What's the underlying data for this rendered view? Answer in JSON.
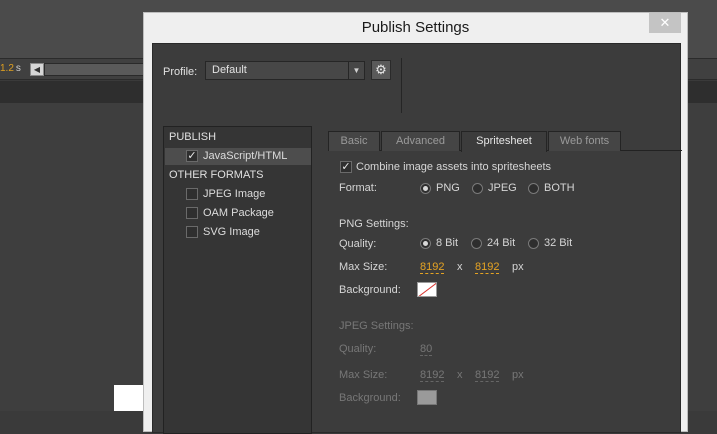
{
  "background": {
    "time_value": "1.2",
    "time_unit": "s",
    "scroll_left_glyph": "◀"
  },
  "dialog": {
    "title": "Publish Settings",
    "close_glyph": "✕",
    "profile_label": "Profile:",
    "profile_value": "Default",
    "profile_arrow": "▼",
    "gear_glyph": "⚙"
  },
  "left_panel": {
    "publish_header": "PUBLISH",
    "other_header": "OTHER FORMATS",
    "items": [
      {
        "label": "JavaScript/HTML",
        "check": "✓"
      },
      {
        "label": "JPEG Image",
        "check": ""
      },
      {
        "label": "OAM Package",
        "check": ""
      },
      {
        "label": "SVG Image",
        "check": ""
      }
    ]
  },
  "tabs": [
    {
      "label": "Basic"
    },
    {
      "label": "Advanced"
    },
    {
      "label": "Spritesheet"
    },
    {
      "label": "Web fonts"
    }
  ],
  "spritesheet": {
    "combine_check": "✓",
    "combine_label": "Combine image assets into spritesheets",
    "format_label": "Format:",
    "formats": [
      "PNG",
      "JPEG",
      "BOTH"
    ],
    "selected_format": "PNG",
    "png": {
      "header": "PNG Settings:",
      "quality_label": "Quality:",
      "qualities": [
        "8 Bit",
        "24 Bit",
        "32 Bit"
      ],
      "selected_quality": "8 Bit",
      "max_size_label": "Max Size:",
      "width": "8192",
      "times": "x",
      "height": "8192",
      "unit": "px",
      "background_label": "Background:"
    },
    "jpeg": {
      "header": "JPEG Settings:",
      "quality_label": "Quality:",
      "quality_value": "80",
      "max_size_label": "Max Size:",
      "width": "8192",
      "times": "x",
      "height": "8192",
      "unit": "px",
      "background_label": "Background:"
    }
  }
}
